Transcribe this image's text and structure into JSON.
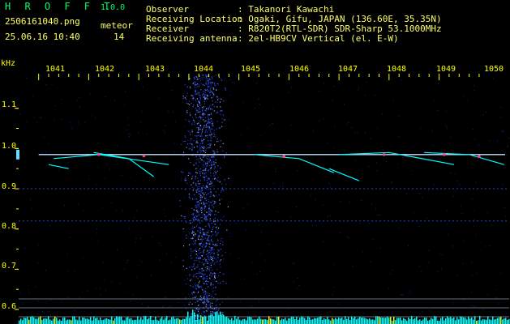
{
  "app": {
    "name": "H R O F F T",
    "version": "1.0.0"
  },
  "capture": {
    "filename": "2506161040.png",
    "timestamp": "25.06.16 10:40",
    "meteor_label": "meteor",
    "meteor_count": "14"
  },
  "info": [
    {
      "label": "Observer",
      "value": ": Takanori Kawachi"
    },
    {
      "label": "Receiving Location",
      "value": ": Ogaki, Gifu, JAPAN (136.60E, 35.35N)"
    },
    {
      "label": "Receiver",
      "value": ": R820T2(RTL-SDR) SDR-Sharp 53.1000MHz"
    },
    {
      "label": "Receiving antenna",
      "value": ": 2el-HB9CV Vertical (el. E-W)"
    }
  ],
  "chart_data": {
    "type": "heatmap",
    "ylabel": "kHz",
    "x_ticks": [
      "1041",
      "1042",
      "1043",
      "1044",
      "1045",
      "1046",
      "1047",
      "1048",
      "1049",
      "1050"
    ],
    "y_ticks": [
      "1.1",
      "1.0",
      "0.9",
      "0.8",
      "0.7",
      "0.6"
    ],
    "x_range": [
      1040.6,
      1050.4
    ],
    "y_range": [
      0.58,
      1.2
    ],
    "carrier_khz": 0.985,
    "colors": {
      "background": "#000000",
      "carrier": "#ccddff",
      "noise": "#2244ff",
      "tick": "#ffff00",
      "trace": "#00ffff"
    }
  }
}
